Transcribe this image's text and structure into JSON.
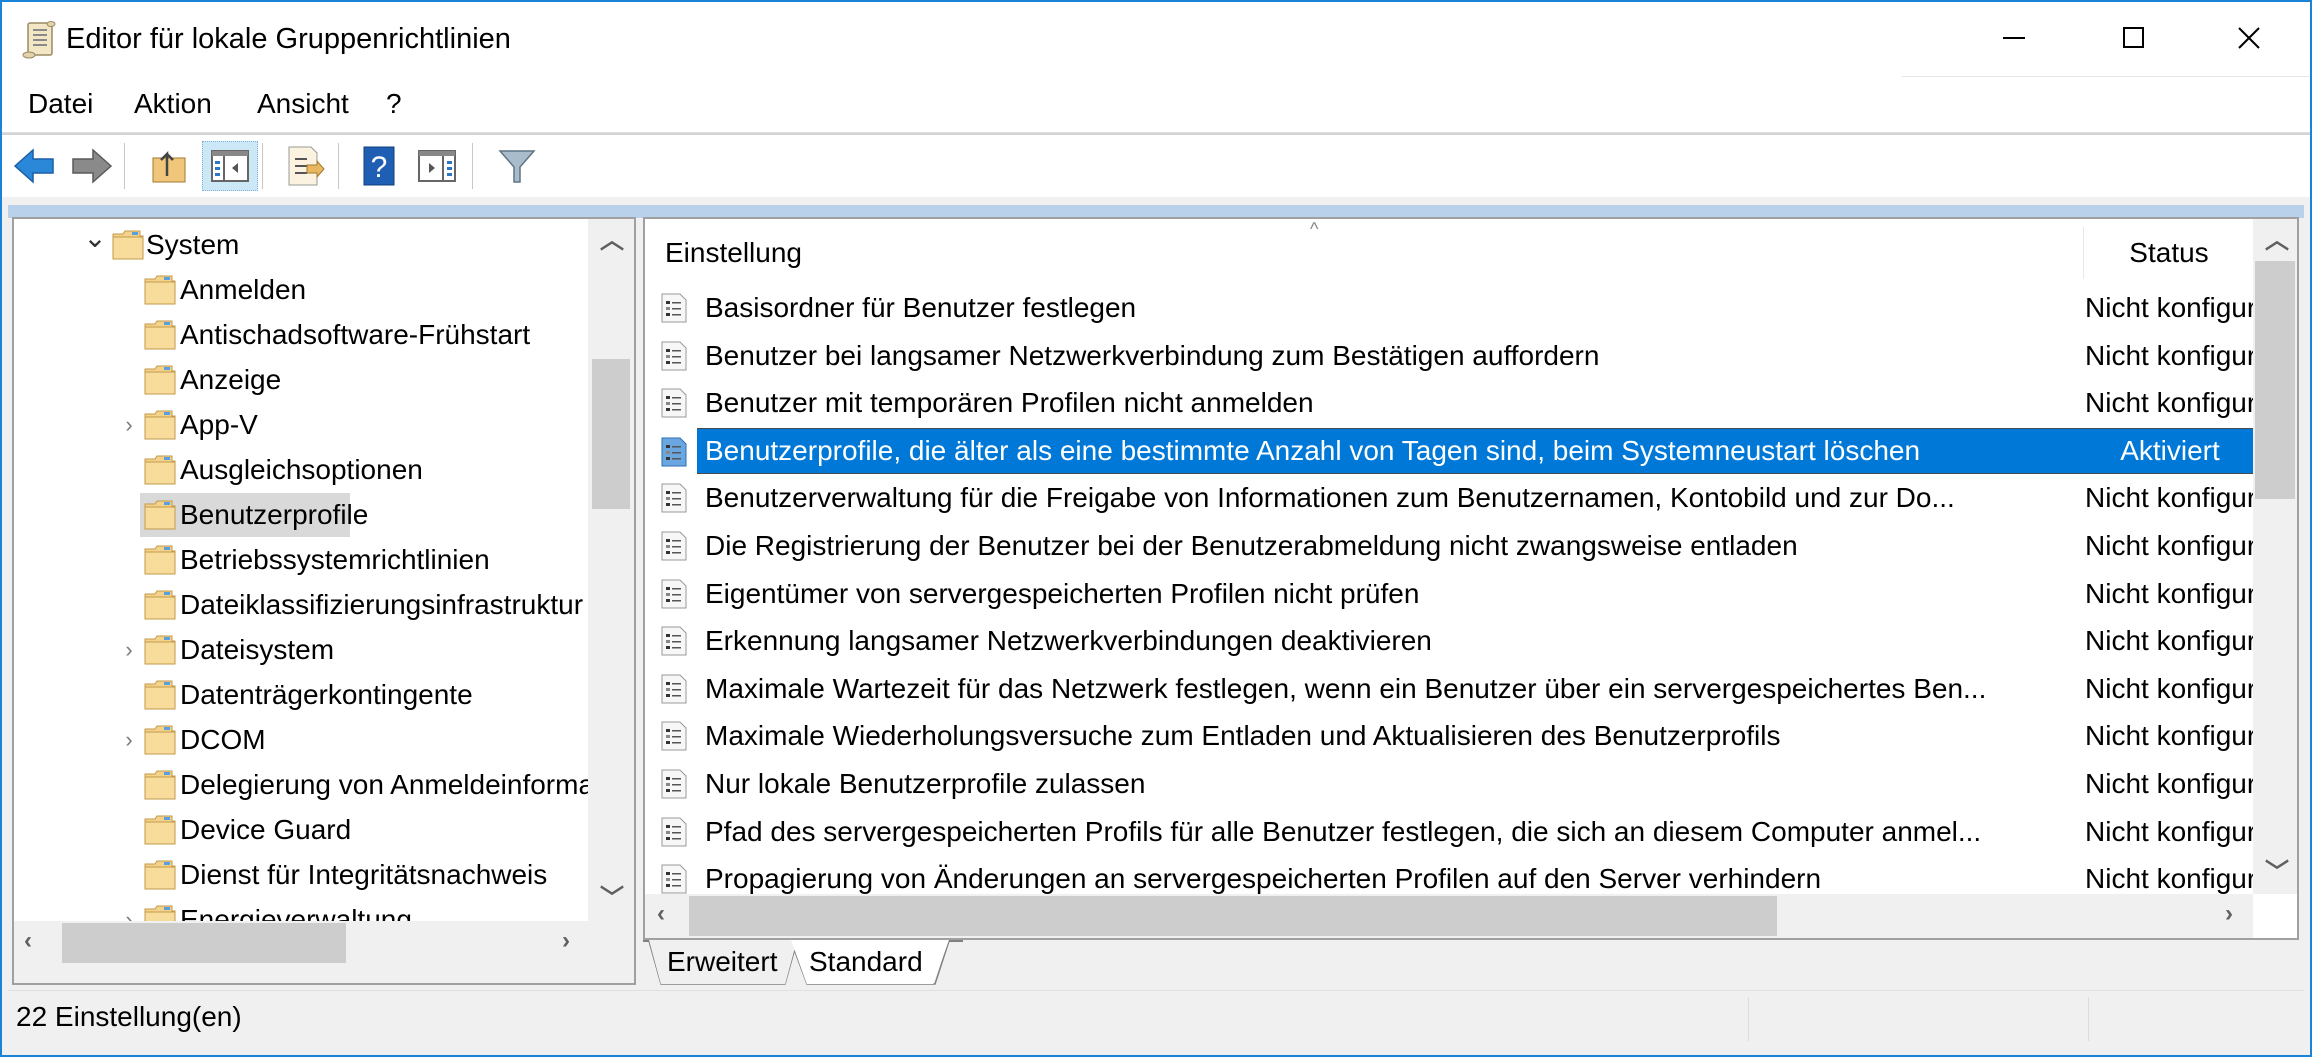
{
  "window": {
    "title": "Editor für lokale Gruppenrichtlinien",
    "controls": {
      "minimize": "minimize",
      "maximize": "maximize",
      "close": "close"
    }
  },
  "menu": [
    "Datei",
    "Aktion",
    "Ansicht",
    "?"
  ],
  "toolbar": {
    "buttons": [
      {
        "name": "back",
        "icon": "back-arrow-icon"
      },
      {
        "name": "forward",
        "icon": "forward-arrow-icon"
      },
      {
        "name": "up-one-level",
        "icon": "folder-up-icon"
      },
      {
        "name": "show-hide-console-tree",
        "icon": "console-tree-icon",
        "active": true
      },
      {
        "name": "export-list",
        "icon": "export-list-icon"
      },
      {
        "name": "help",
        "icon": "help-icon"
      },
      {
        "name": "show-hide-action-pane",
        "icon": "action-pane-icon"
      },
      {
        "name": "filter",
        "icon": "filter-icon"
      }
    ]
  },
  "tree": {
    "items": [
      {
        "label": "System",
        "level": 0,
        "expander": "expanded"
      },
      {
        "label": "Anmelden",
        "level": 1,
        "expander": "none"
      },
      {
        "label": "Antischadsoftware-Frühstart",
        "level": 1,
        "expander": "none"
      },
      {
        "label": "Anzeige",
        "level": 1,
        "expander": "none"
      },
      {
        "label": "App-V",
        "level": 1,
        "expander": "collapsed"
      },
      {
        "label": "Ausgleichsoptionen",
        "level": 1,
        "expander": "none"
      },
      {
        "label": "Benutzerprofile",
        "level": 1,
        "expander": "none",
        "selected": true
      },
      {
        "label": "Betriebssystemrichtlinien",
        "level": 1,
        "expander": "none"
      },
      {
        "label": "Dateiklassifizierungsinfrastruktur",
        "level": 1,
        "expander": "none"
      },
      {
        "label": "Dateisystem",
        "level": 1,
        "expander": "collapsed"
      },
      {
        "label": "Datenträgerkontingente",
        "level": 1,
        "expander": "none"
      },
      {
        "label": "DCOM",
        "level": 1,
        "expander": "collapsed"
      },
      {
        "label": "Delegierung von Anmeldeinformationen",
        "level": 1,
        "expander": "none"
      },
      {
        "label": "Device Guard",
        "level": 1,
        "expander": "none"
      },
      {
        "label": "Dienst für Integritätsnachweis",
        "level": 1,
        "expander": "none"
      },
      {
        "label": "Energieverwaltung",
        "level": 1,
        "expander": "collapsed"
      }
    ]
  },
  "list": {
    "columns": {
      "setting": "Einstellung",
      "status": "Status"
    },
    "sort_indicator": "^",
    "rows": [
      {
        "setting": "Basisordner für Benutzer festlegen",
        "status": "Nicht konfiguriert"
      },
      {
        "setting": "Benutzer bei langsamer Netzwerkverbindung zum Bestätigen auffordern",
        "status": "Nicht konfiguriert"
      },
      {
        "setting": "Benutzer mit temporären Profilen nicht anmelden",
        "status": "Nicht konfiguriert"
      },
      {
        "setting": "Benutzerprofile, die älter als eine bestimmte Anzahl von Tagen sind, beim Systemneustart löschen",
        "status": "Aktiviert",
        "selected": true
      },
      {
        "setting": "Benutzerverwaltung für die Freigabe von Informationen zum Benutzernamen, Kontobild und zur Do...",
        "status": "Nicht konfiguriert"
      },
      {
        "setting": "Die Registrierung der Benutzer bei der Benutzerabmeldung nicht zwangsweise entladen",
        "status": "Nicht konfiguriert"
      },
      {
        "setting": "Eigentümer von servergespeicherten Profilen nicht prüfen",
        "status": "Nicht konfiguriert"
      },
      {
        "setting": "Erkennung langsamer Netzwerkverbindungen deaktivieren",
        "status": "Nicht konfiguriert"
      },
      {
        "setting": "Maximale Wartezeit für das Netzwerk festlegen, wenn ein Benutzer über ein servergespeichertes Ben...",
        "status": "Nicht konfiguriert"
      },
      {
        "setting": "Maximale Wiederholungsversuche zum Entladen und Aktualisieren des Benutzerprofils",
        "status": "Nicht konfiguriert"
      },
      {
        "setting": "Nur lokale Benutzerprofile zulassen",
        "status": "Nicht konfiguriert"
      },
      {
        "setting": "Pfad des servergespeicherten Profils für alle Benutzer festlegen, die sich an diesem Computer anmel...",
        "status": "Nicht konfiguriert"
      },
      {
        "setting": "Propagierung von Änderungen an servergespeicherten Profilen auf den Server verhindern",
        "status": "Nicht konfiguriert"
      }
    ]
  },
  "tabs": [
    {
      "label": "Erweitert",
      "active": false
    },
    {
      "label": "Standard",
      "active": true
    }
  ],
  "statusbar": {
    "text": "22 Einstellung(en)"
  },
  "colors": {
    "selection": "#0078d7",
    "window_border": "#1883d7",
    "tree_selection": "#d9d9d9",
    "band": "#b9d1ea"
  }
}
